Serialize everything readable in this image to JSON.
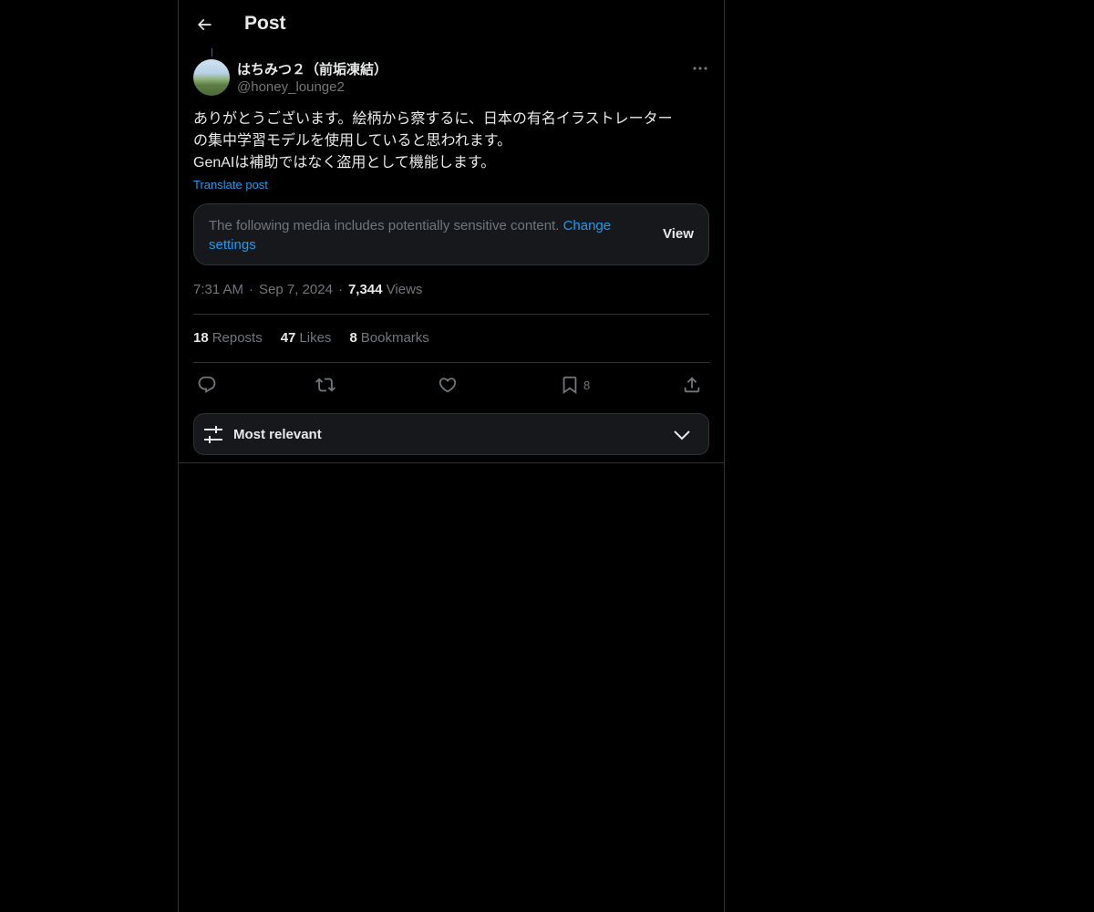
{
  "header": {
    "title": "Post"
  },
  "post": {
    "author_name": "はちみつ２（前垢凍結）",
    "author_handle": "@honey_lounge2",
    "text_lines": [
      "ありがとうございます。絵柄から察するに、日本の有名イラストレーター",
      "の集中学習モデルを使用していると思われます。",
      "GenAIは補助ではなく盗用として機能します。"
    ],
    "translate_label": "Translate post",
    "sensitive_notice": "The following media includes potentially sensitive content.",
    "change_settings_label": "Change settings",
    "view_label": "View",
    "time": "7:31 AM",
    "date": "Sep 7, 2024",
    "views_count": "7,344",
    "views_label": "Views"
  },
  "stats": {
    "reposts_count": "18",
    "reposts_label": "Reposts",
    "likes_count": "47",
    "likes_label": "Likes",
    "bookmarks_count": "8",
    "bookmarks_label": "Bookmarks"
  },
  "actions": {
    "bookmark_count": "8"
  },
  "sort": {
    "label": "Most relevant"
  },
  "colors": {
    "background": "#000000",
    "accent": "#1d9bf0",
    "text_primary": "#e7e9ea",
    "text_secondary": "#71767b",
    "border": "#2f3336",
    "card": "#16181c"
  },
  "icons": [
    "back-arrow-icon",
    "more-icon",
    "reply-icon",
    "repost-icon",
    "like-icon",
    "bookmark-icon",
    "share-icon",
    "filter-icon",
    "chevron-down-icon"
  ]
}
